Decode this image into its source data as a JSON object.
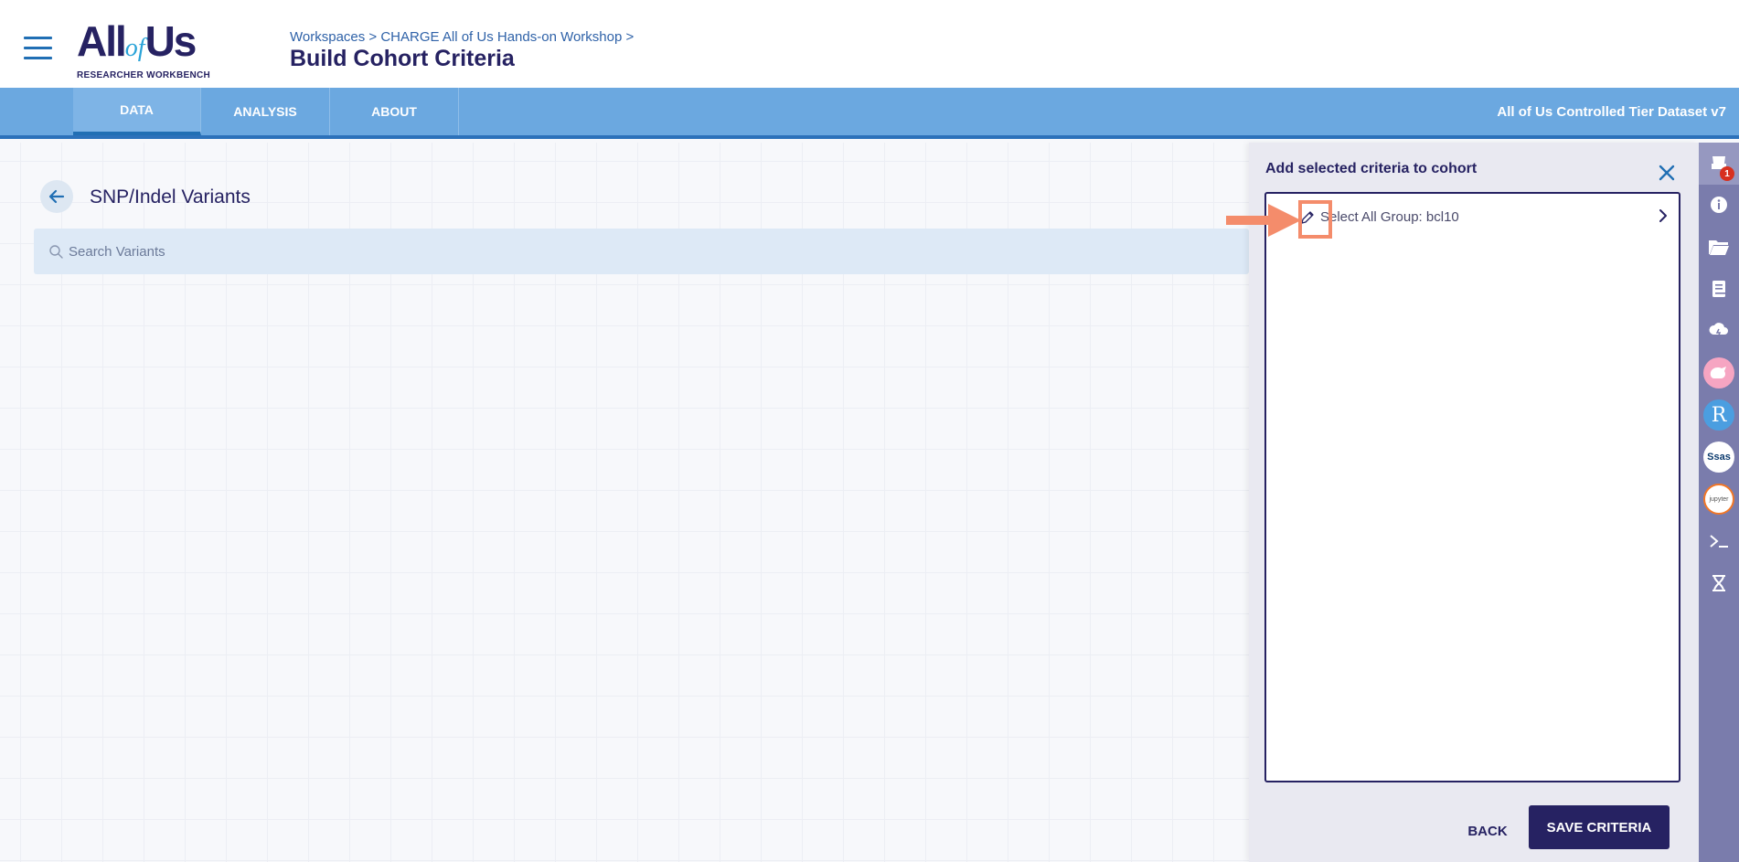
{
  "header": {
    "logo_main": "All",
    "logo_of": "of",
    "logo_us": "Us",
    "logo_sub": "RESEARCHER WORKBENCH",
    "breadcrumb": "Workspaces > CHARGE All of Us Hands-on Workshop >",
    "title": "Build Cohort Criteria"
  },
  "tabs": [
    {
      "label": "DATA",
      "active": true
    },
    {
      "label": "ANALYSIS",
      "active": false
    },
    {
      "label": "ABOUT",
      "active": false
    }
  ],
  "dataset_label": "All of Us Controlled Tier Dataset v7",
  "main": {
    "section_title": "SNP/Indel Variants",
    "search_placeholder": "Search Variants",
    "search_value": ""
  },
  "panel": {
    "title": "Add selected criteria to cohort",
    "selection": {
      "label": "Select All Group: bcl10"
    },
    "back_label": "BACK",
    "save_label": "SAVE CRITERIA"
  },
  "rail": {
    "notification_count": "1",
    "icons": [
      "cohort-criteria-icon",
      "info-icon",
      "folder-icon",
      "notebook-icon",
      "cloud-icon",
      "cromwell-icon",
      "r-studio-icon",
      "sas-icon",
      "jupyter-icon",
      "terminal-icon",
      "genomic-extraction-icon"
    ],
    "r_text": "R",
    "sas_text": "Ssas",
    "jupyter_text": "jupyter"
  },
  "colors": {
    "brand_navy": "#262262",
    "tab_bar": "#6ba8e0",
    "rail": "#7a7cac",
    "highlight": "#f48c6b"
  }
}
